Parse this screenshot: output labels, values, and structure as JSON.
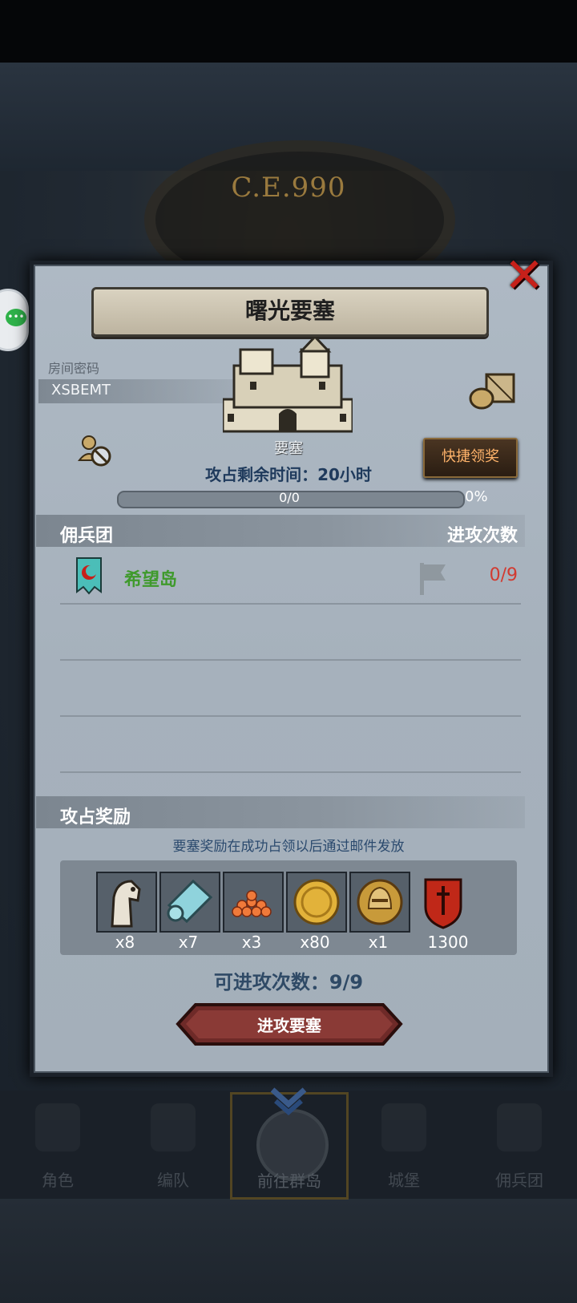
{
  "header": {
    "era": "C.E.990"
  },
  "dialog": {
    "title": "曙光要塞",
    "room_password_label": "房间密码",
    "room_password": "XSBEMT",
    "fortress_label": "要塞",
    "quick_claim_label": "快捷领奖",
    "time_left": "攻占剩余时间：20小时",
    "progress": {
      "text": "0/0",
      "percent": "0%",
      "fraction": 0
    },
    "mercenary_header": "佣兵团",
    "attack_count_header": "进攻次数",
    "mercenaries": [
      {
        "name": "希望岛",
        "attacks": "0/9"
      }
    ],
    "reward_header": "攻占奖励",
    "reward_note": "要塞奖励在成功占领以后通过邮件发放",
    "rewards": [
      {
        "icon": "horse-icon",
        "qty": "x8"
      },
      {
        "icon": "cloth-icon",
        "qty": "x7"
      },
      {
        "icon": "roe-icon",
        "qty": "x3"
      },
      {
        "icon": "gold-coin-icon",
        "qty": "x80"
      },
      {
        "icon": "helmet-coin-icon",
        "qty": "x1"
      },
      {
        "icon": "honor-shield-icon",
        "qty": "1300"
      }
    ],
    "attempts_left": "可进攻次数：9/9",
    "attack_button": "进攻要塞"
  },
  "nav": {
    "items": [
      {
        "label": "角色",
        "icon": "character-icon"
      },
      {
        "label": "编队",
        "icon": "formation-icon"
      },
      {
        "label": "前往群岛",
        "icon": "islands-icon"
      },
      {
        "label": "城堡",
        "icon": "castle-icon"
      },
      {
        "label": "佣兵团",
        "icon": "mercenary-icon"
      }
    ]
  },
  "colors": {
    "panel": "#aab4bf",
    "close": "#c6201a",
    "merc_name": "#3f9a2c",
    "attack_count": "#d23a30"
  }
}
